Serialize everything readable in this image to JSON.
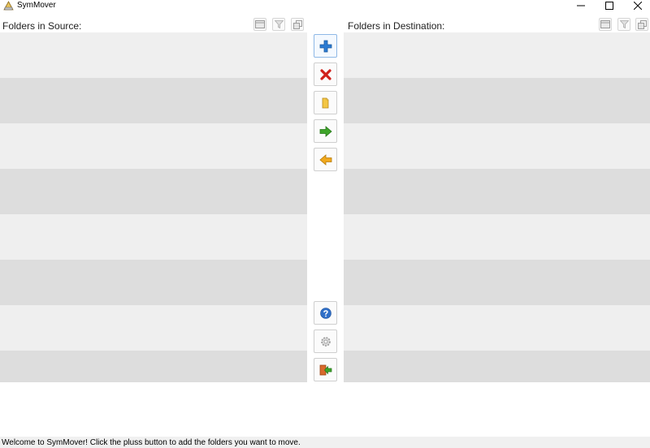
{
  "window": {
    "title": "SymMover",
    "icon": "symmover-app-icon",
    "controls": [
      "minimize-icon",
      "maximize-icon",
      "close-icon"
    ]
  },
  "source_panel": {
    "label": "Folders in Source:",
    "header_buttons": [
      "columns-icon",
      "filter-icon",
      "copy-icon"
    ],
    "rows": 8
  },
  "destination_panel": {
    "label": "Folders in Destination:",
    "header_buttons": [
      "columns-icon",
      "filter-icon",
      "copy-icon"
    ],
    "rows": 8
  },
  "toolbar": {
    "top": [
      "add-icon",
      "remove-icon",
      "folder-icon",
      "move-right-icon",
      "move-left-icon"
    ],
    "bottom": [
      "help-icon",
      "settings-icon",
      "exit-icon"
    ]
  },
  "colors": {
    "row_light": "#efefef",
    "row_dark": "#dddddd",
    "add_blue": "#2b7bd3",
    "remove_red": "#d0201a",
    "arrow_green": "#3fa52a",
    "arrow_orange": "#f0a81c"
  },
  "status": {
    "text": "Welcome to SymMover! Click the pluss button to add the folders you want to move."
  }
}
